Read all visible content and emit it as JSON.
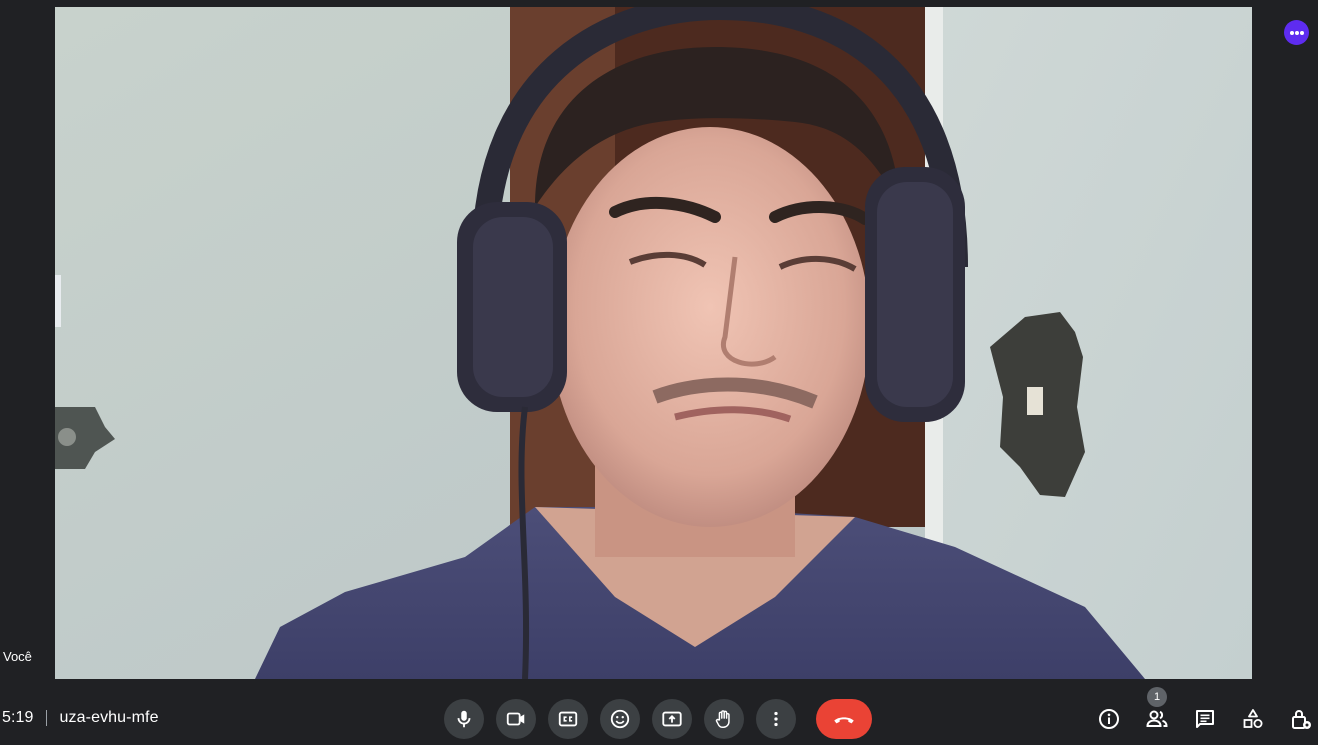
{
  "participant": {
    "name_label": "Você"
  },
  "meeting": {
    "time": "5:19",
    "code": "uza-evhu-mfe"
  },
  "controls": {
    "icons": [
      "microphone-icon",
      "camera-icon",
      "captions-icon",
      "emoji-icon",
      "present-screen-icon",
      "raise-hand-icon",
      "more-vert-icon",
      "end-call-icon"
    ],
    "end_call_color": "#ea4335",
    "button_color": "#3c4043"
  },
  "right_panel": {
    "icons": [
      "info-icon",
      "people-icon",
      "chat-icon",
      "activities-icon",
      "host-controls-icon"
    ],
    "people_count": "1"
  },
  "colors": {
    "background": "#202124",
    "accent": "#5e2cf0"
  }
}
